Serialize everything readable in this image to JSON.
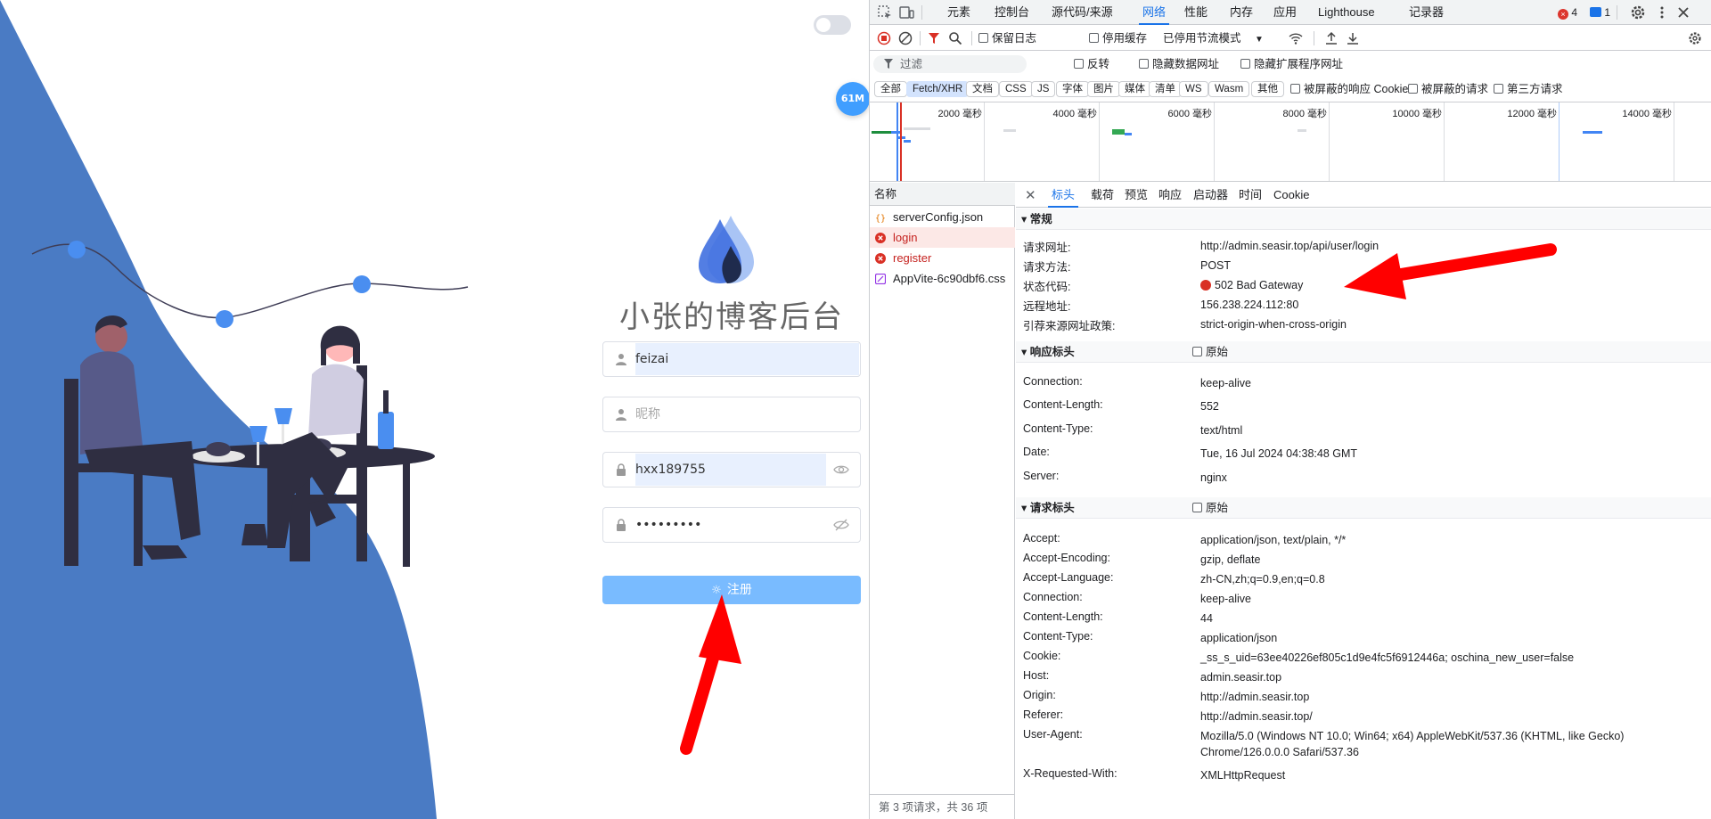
{
  "app": {
    "title": "小张的博客后台",
    "memory_badge": "61M",
    "form": {
      "username_value": "feizai",
      "nickname_placeholder": "昵称",
      "password_value": "hxx189755",
      "confirm_password_value": "•••••••••",
      "register_label": "注册"
    }
  },
  "devtools": {
    "tabs": [
      "元素",
      "控制台",
      "源代码/来源",
      "网络",
      "性能",
      "内存",
      "应用",
      "Lighthouse",
      "记录器"
    ],
    "active_tab": "网络",
    "error_count": "4",
    "message_count": "1",
    "toolbar": {
      "preserve_log": "保留日志",
      "disable_cache": "停用缓存",
      "throttle": "已停用节流模式"
    },
    "filter": {
      "placeholder": "过滤",
      "invert": "反转",
      "hide_data_urls": "隐藏数据网址",
      "hide_ext_urls": "隐藏扩展程序网址"
    },
    "types": [
      "全部",
      "Fetch/XHR",
      "文档",
      "CSS",
      "JS",
      "字体",
      "图片",
      "媒体",
      "清单",
      "WS",
      "Wasm",
      "其他"
    ],
    "active_type": "Fetch/XHR",
    "type_options": {
      "blocked_cookies": "被屏蔽的响应 Cookie",
      "blocked_requests": "被屏蔽的请求",
      "third_party": "第三方请求"
    },
    "timeline_ticks": [
      "2000 毫秒",
      "4000 毫秒",
      "6000 毫秒",
      "8000 毫秒",
      "10000 毫秒",
      "12000 毫秒",
      "14000 毫秒"
    ],
    "name_header": "名称",
    "requests": [
      {
        "name": "serverConfig.json",
        "type": "json",
        "error": false
      },
      {
        "name": "login",
        "type": "error",
        "error": true
      },
      {
        "name": "register",
        "type": "error",
        "error": true
      },
      {
        "name": "AppVite-6c90dbf6.css",
        "type": "css",
        "error": false
      }
    ],
    "footer": "第 3 项请求，共 36 项",
    "detail_tabs": [
      "标头",
      "载荷",
      "预览",
      "响应",
      "启动器",
      "时间",
      "Cookie"
    ],
    "active_detail_tab": "标头",
    "general": {
      "title": "常规",
      "rows": [
        {
          "k": "请求网址:",
          "v": "http://admin.seasir.top/api/user/login"
        },
        {
          "k": "请求方法:",
          "v": "POST"
        },
        {
          "k": "状态代码:",
          "v": "502 Bad Gateway"
        },
        {
          "k": "远程地址:",
          "v": "156.238.224.112:80"
        },
        {
          "k": "引荐来源网址政策:",
          "v": "strict-origin-when-cross-origin"
        }
      ]
    },
    "response_headers": {
      "title": "响应标头",
      "raw": "原始",
      "rows": [
        {
          "k": "Connection:",
          "v": "keep-alive"
        },
        {
          "k": "Content-Length:",
          "v": "552"
        },
        {
          "k": "Content-Type:",
          "v": "text/html"
        },
        {
          "k": "Date:",
          "v": "Tue, 16 Jul 2024 04:38:48 GMT"
        },
        {
          "k": "Server:",
          "v": "nginx"
        }
      ]
    },
    "request_headers": {
      "title": "请求标头",
      "raw": "原始",
      "rows": [
        {
          "k": "Accept:",
          "v": "application/json, text/plain, */*"
        },
        {
          "k": "Accept-Encoding:",
          "v": "gzip, deflate"
        },
        {
          "k": "Accept-Language:",
          "v": "zh-CN,zh;q=0.9,en;q=0.8"
        },
        {
          "k": "Connection:",
          "v": "keep-alive"
        },
        {
          "k": "Content-Length:",
          "v": "44"
        },
        {
          "k": "Content-Type:",
          "v": "application/json"
        },
        {
          "k": "Cookie:",
          "v": "_ss_s_uid=63ee40226ef805c1d9e4fc5f6912446a; oschina_new_user=false"
        },
        {
          "k": "Host:",
          "v": "admin.seasir.top"
        },
        {
          "k": "Origin:",
          "v": "http://admin.seasir.top"
        },
        {
          "k": "Referer:",
          "v": "http://admin.seasir.top/"
        },
        {
          "k": "User-Agent:",
          "v": "Mozilla/5.0 (Windows NT 10.0; Win64; x64) AppleWebKit/537.36 (KHTML, like Gecko) Chrome/126.0.0.0 Safari/537.36"
        },
        {
          "k": "X-Requested-With:",
          "v": "XMLHttpRequest"
        }
      ]
    }
  },
  "colors": {
    "brand_blue": "#4a7bc4",
    "button_blue": "#79bbff",
    "error_red": "#d93025",
    "annotation_red": "#ff0000"
  }
}
